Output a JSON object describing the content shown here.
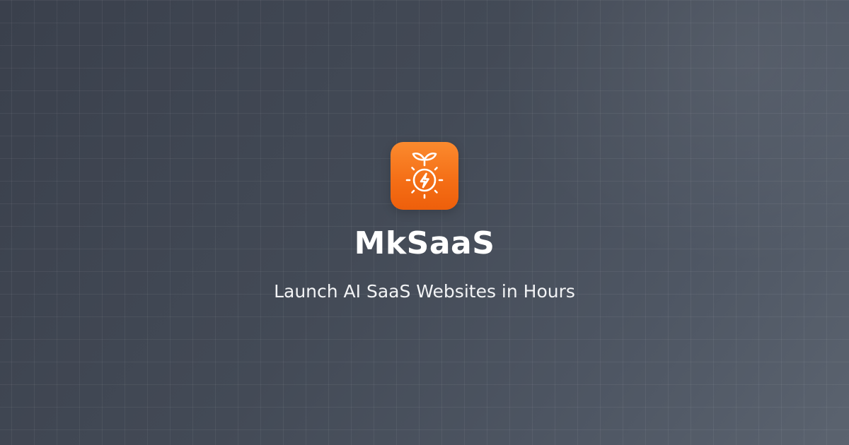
{
  "brand": {
    "name": "MkSaaS",
    "tagline": "Launch AI SaaS Websites in Hours",
    "logo_icon": "sprout-lightning-bolt-icon"
  },
  "colors": {
    "background": "#434a56",
    "accent": "#f46d15",
    "text": "#ffffff"
  }
}
